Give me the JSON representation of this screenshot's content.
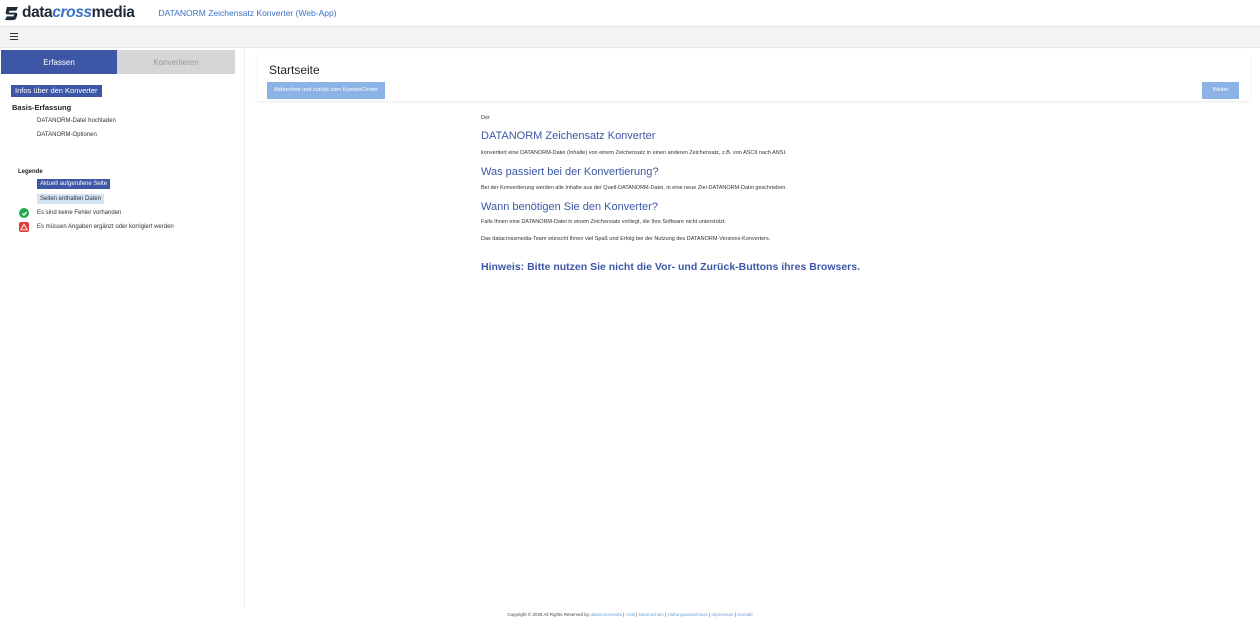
{
  "header": {
    "logo_part1": "data",
    "logo_part2": "cross",
    "logo_part3": "media",
    "app_title": "DATANORM Zeichensatz Konverter (Web-App)"
  },
  "menu": {
    "icon": "hamburger-icon"
  },
  "sidebar": {
    "tabs": [
      {
        "label": "Erfassen",
        "active": true
      },
      {
        "label": "Konvertieren",
        "active": false
      }
    ],
    "info_button": "Infos über den Konverter",
    "section_title": "Basis-Erfassung",
    "items": [
      {
        "label": "DATANORM-Datei hochladen"
      },
      {
        "label": "DATANORM-Optionen"
      }
    ],
    "legend": {
      "title": "Legende",
      "current_page": "Aktuell aufgerufene Seite",
      "has_data": "Seiten enthalten Daten",
      "ok": "Es sind keine Fehler vorhanden",
      "warn": "Es müssen Angaben ergänzt oder korrigiert werden"
    }
  },
  "content": {
    "page_title": "Startseite",
    "abort_button": "Abbrechen und zurück zum KundenCenter",
    "next_button": "Weiter"
  },
  "main": {
    "intro": "Der",
    "heading1": "DATANORM Zeichensatz Konverter",
    "text1": "konvertiert eine DATANORM-Datei (Inhalte) von einem Zeichensatz in einen anderen Zeichensatz, z.B. von ASCII nach ANSI.",
    "heading2": "Was passiert bei der Konvertierung?",
    "text2": "Bei der Konvertierung werden alle Inhalte aus der Quell-DATANORM-Datei, in eine neue Ziel-DATANORM-Datei geschrieben.",
    "heading3": "Wann benötigen Sie den Konverter?",
    "text3": "Falls Ihnen eine DATANORM-Datei in einem Zeichensatz vorliegt, die Ihre Software nicht unterstützt.",
    "text4": "Das datacrossmedia-Team wünscht Ihnen viel Spaß und Erfolg bei der Nutzung des DATANORM-Versions-Konverters.",
    "hint": "Hinweis: Bitte nutzen Sie nicht die Vor- und Zurück-Buttons ihres Browsers."
  },
  "footer": {
    "copyright": "Copyright © 2026 All Rights Reserved by",
    "links": [
      "datacrossmedia",
      "AGB",
      "Datenschutz",
      "Haftungsausschluss",
      "Impressum",
      "Kontakt"
    ],
    "sep": "|"
  },
  "colors": {
    "primary": "#3d57a6",
    "button_light": "#8bb3e6",
    "ok": "#22aa4a",
    "warn": "#e53a3a"
  }
}
